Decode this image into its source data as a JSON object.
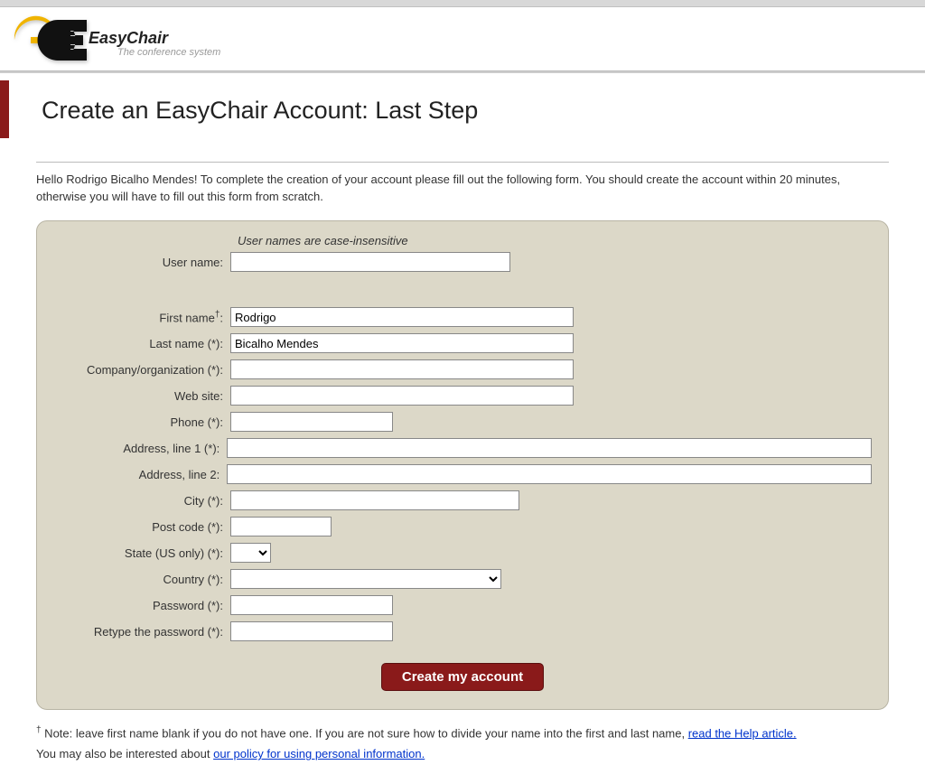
{
  "brand": {
    "title": "EasyChair",
    "subtitle": "The conference system"
  },
  "page": {
    "title": "Create an EasyChair Account: Last Step"
  },
  "instruction": "Hello Rodrigo Bicalho Mendes! To complete the creation of your account please fill out the following form. You should create the account within 20 minutes, otherwise you will have to fill out this form from scratch.",
  "form": {
    "hint": "User names are case-insensitive",
    "labels": {
      "username": "User name:",
      "firstname": "First name",
      "firstname_suffix": ":",
      "lastname": "Last name (*):",
      "company": "Company/organization (*):",
      "website": "Web site:",
      "phone": "Phone (*):",
      "address1": "Address, line 1 (*):",
      "address2": "Address, line 2:",
      "city": "City (*):",
      "postcode": "Post code (*):",
      "state": "State (US only) (*):",
      "country": "Country (*):",
      "password": "Password (*):",
      "password2": "Retype the password (*):"
    },
    "values": {
      "username": "",
      "firstname": "Rodrigo",
      "lastname": "Bicalho Mendes",
      "company": "",
      "website": "",
      "phone": "",
      "address1": "",
      "address2": "",
      "city": "",
      "postcode": "",
      "state": "",
      "country": "",
      "password": "",
      "password2": ""
    },
    "submit": "Create my account"
  },
  "footnote": {
    "dagger": "†",
    "note_prefix": " Note: leave first name blank if you do not have one. If you are not sure how to divide your name into the first and last name, ",
    "help_link": "read the Help article.",
    "line2_prefix": "You may also be interested about ",
    "policy_link": "our policy for using personal information."
  }
}
